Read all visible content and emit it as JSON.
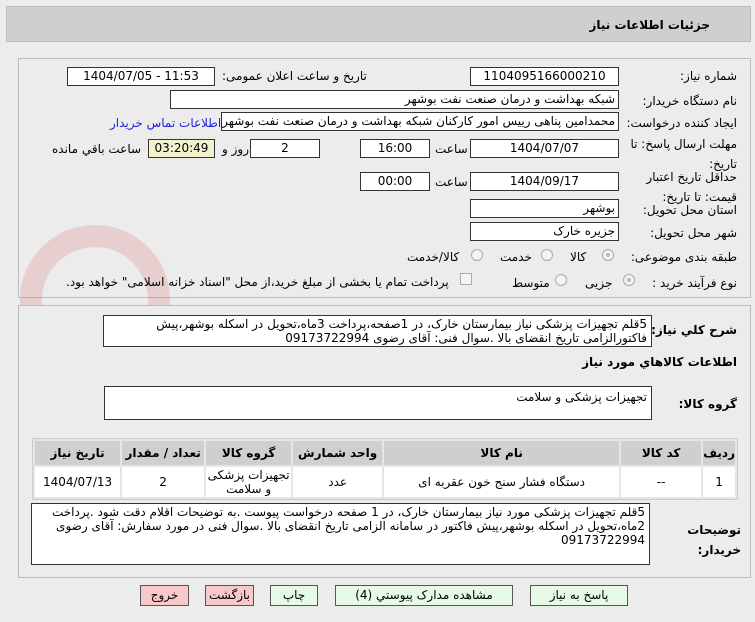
{
  "header": {
    "title": "جزئیات اطلاعات نیاز"
  },
  "form": {
    "need_number_label": "شماره نیاز:",
    "need_number": "1104095166000210",
    "announce_label": "تاریخ و ساعت اعلان عمومی:",
    "announce_value": "1404/07/05 - 11:53",
    "buyer_label": "نام دستگاه خریدار:",
    "buyer_value": "شبکه بهداشت و درمان صنعت نفت بوشهر",
    "creator_label": "ایجاد کننده درخواست:",
    "creator_value": "محمدامین پناهی رییس امور کارکنان شبکه بهداشت و درمان صنعت نفت بوشهر",
    "contact_link": "اطلاعات تماس خریدار",
    "deadline_label": "مهلت ارسال پاسخ: تا تاریخ:",
    "deadline_date": "1404/07/07",
    "time_label": "ساعت",
    "deadline_time": "16:00",
    "days": "2",
    "days_label": "روز و",
    "remaining": "03:20:49",
    "remaining_label": "ساعت باقي مانده",
    "validity_label": "حداقل تاریخ اعتبار قیمت: تا تاریخ:",
    "validity_date": "1404/09/17",
    "validity_time": "00:00",
    "province_label": "استان محل تحویل:",
    "province": "بوشهر",
    "city_label": "شهر محل تحویل:",
    "city": "جزیره خارک",
    "category_label": "طبقه بندی موضوعی:",
    "category_options": [
      "کالا",
      "خدمت",
      "کالا/خدمت"
    ],
    "process_label": "نوع فرآیند خرید :",
    "process_options": [
      "جزیی",
      "متوسط"
    ],
    "payment_note": "پرداخت تمام یا بخشی از مبلغ خرید،از محل \"اسناد خزانه اسلامی\" خواهد بود."
  },
  "details": {
    "desc_label": "شرح کلي نياز:",
    "desc": "5قلم تجهیزات پزشکی نیاز بیمارستان خارک، در 1صفحه،پرداخت 3ماه،تحویل در اسکله بوشهر،پیش فاکتورالزامی تاریخ انقضای بالا .سوال فنی:  آقای رضوی 09173722994",
    "goods_title": "اطلاعات کالاهاي مورد نياز",
    "group_label": "گروه کالا:",
    "group": "تجهیزات پزشکی و سلامت",
    "columns": [
      "ردیف",
      "کد کالا",
      "نام کالا",
      "واحد شمارش",
      "گروه کالا",
      "تعداد / مقدار",
      "تاریخ نیاز"
    ],
    "rows": [
      [
        "1",
        "--",
        "دستگاه فشار سنج خون عقربه ای",
        "عدد",
        "تجهیزات پزشکی و سلامت",
        "2",
        "1404/07/13"
      ]
    ],
    "notes_label": "توضیحات خریدار:",
    "notes": "5قلم تجهیزات پزشکی مورد نیاز بیمارستان خارک، در 1  صفحه درخواست پیوست  .به توضیحات اقلام دقت شود .پرداخت 2ماه،تحویل در اسکله بوشهر،پیش فاکتور در سامانه الزامی تاریخ انقضای بالا .سوال فنی در مورد سفارش:  آقای رضوی 09173722994"
  },
  "buttons": {
    "reply": "پاسخ به نیاز",
    "docs": "مشاهده مدارک پیوستي (4)",
    "print": "چاپ",
    "back": "بازگشت",
    "exit": "خروج"
  }
}
